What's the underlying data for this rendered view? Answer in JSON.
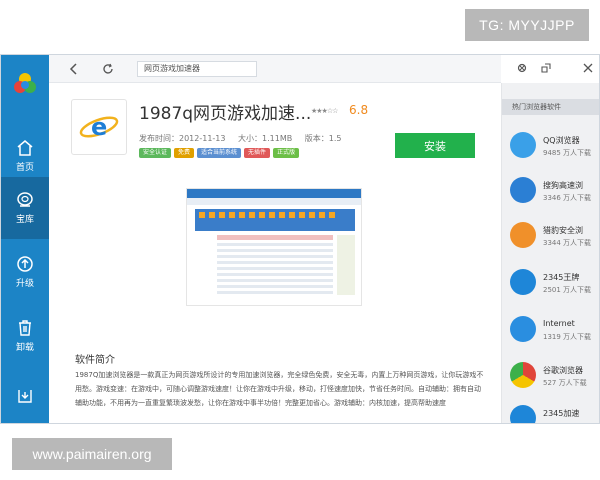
{
  "watermarks": {
    "top": "TG: MYYJJPP",
    "bottom": "www.paimairen.org"
  },
  "sidebar": {
    "items": [
      {
        "label": "首页",
        "icon": "home-icon"
      },
      {
        "label": "宝库",
        "icon": "store-icon",
        "active": true
      },
      {
        "label": "升级",
        "icon": "upgrade-icon"
      },
      {
        "label": "卸载",
        "icon": "uninstall-icon"
      },
      {
        "label": "",
        "icon": "download-icon"
      }
    ]
  },
  "topbar": {
    "address": "网页游戏加速器"
  },
  "app": {
    "title": "1987q网页游戏加速...",
    "rating": "6.8",
    "publish_time": "发布时间：2012-11-13",
    "size": "大小：1.11MB",
    "version": "版本：1.5",
    "tags": [
      "安全认证",
      "免费",
      "适合当前系统",
      "无插件",
      "正式版"
    ],
    "tag_colors": [
      "#5cb85c",
      "#e0a000",
      "#5b8fd1",
      "#e05858",
      "#6cbf47"
    ],
    "install_label": "安装"
  },
  "intro": {
    "title": "软件简介",
    "text": "1987Q加速浏览器是一款真正为网页游戏所设计的专用加速浏览器，完全绿色免费，安全无毒，内置上万种网页游戏，让你玩游戏不用愁。游戏变速：在游戏中，可随心调整游戏速度！让你在游戏中升级，移动，打怪速度加快，节省任务时间。自动辅助：拥有自动辅助功能，不用再为一直重复繁琐波发愁，让你在游戏中事半功倍！完整更加省心。游戏辅助：内核加速，提高帮助速度"
  },
  "recommend": {
    "title": "热门浏览器软件",
    "items": [
      {
        "name": "QQ浏览器",
        "count": "9485 万人下载",
        "icon": "qq-browser-icon",
        "color": "#3aa0e8"
      },
      {
        "name": "搜狗高速浏",
        "count": "3346 万人下载",
        "icon": "sogou-browser-icon",
        "color": "#2b7fd4"
      },
      {
        "name": "猎豹安全浏",
        "count": "3344 万人下载",
        "icon": "liebao-browser-icon",
        "color": "#f0902a"
      },
      {
        "name": "2345王牌",
        "count": "2501 万人下载",
        "icon": "2345-browser-icon",
        "color": "#1e86d8"
      },
      {
        "name": "Internet",
        "count": "1319 万人下载",
        "icon": "ie-icon",
        "color": "#2a8ee0"
      },
      {
        "name": "谷歌浏览器",
        "count": "527 万人下载",
        "icon": "chrome-icon",
        "color": "#e0453a"
      },
      {
        "name": "2345加速",
        "count": "",
        "icon": "2345-speed-icon",
        "color": "#1e86d8"
      }
    ]
  }
}
